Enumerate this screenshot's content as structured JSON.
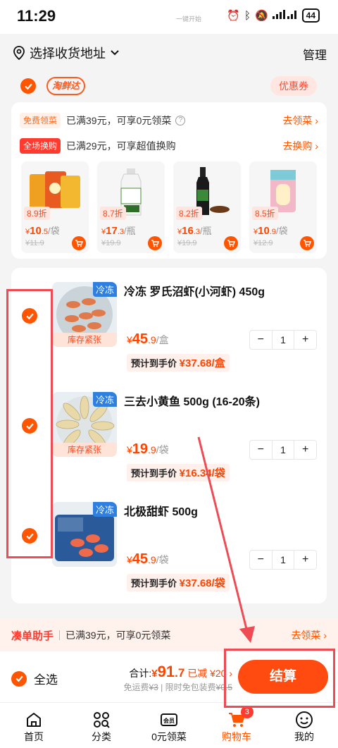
{
  "status_bar": {
    "time": "11:29",
    "carrier": "一键开始",
    "battery": "44"
  },
  "header": {
    "address_label": "选择收货地址",
    "manage": "管理"
  },
  "store": {
    "logo": "淘鲜达",
    "coupon": "优惠券"
  },
  "promos": [
    {
      "tag": "免费领菜",
      "text": "已满39元，可享0元领菜",
      "link": "去领菜 ›"
    },
    {
      "tag": "全场换购",
      "text": "已满29元，可享超值换购",
      "link": "去换购 ›"
    }
  ],
  "recommend": [
    {
      "discount": "8.9折",
      "price_int": "10",
      "price_dec": ".5",
      "unit": "/袋",
      "orig": "¥11.9"
    },
    {
      "discount": "8.7折",
      "price_int": "17",
      "price_dec": ".3",
      "unit": "/瓶",
      "orig": "¥19.9"
    },
    {
      "discount": "8.2折",
      "price_int": "16",
      "price_dec": ".3",
      "unit": "/瓶",
      "orig": "¥19.9"
    },
    {
      "discount": "8.5折",
      "price_int": "10",
      "price_dec": ".9",
      "unit": "/袋",
      "orig": "¥12.9"
    }
  ],
  "cart_items": [
    {
      "tag": "冷冻",
      "stock": "库存紧张",
      "title": "冷冻 罗氏沼虾(小河虾) 450g",
      "price_int": "45",
      "price_dec": ".9",
      "unit": "/盒",
      "qty": "1",
      "est_label": "预计到手价",
      "est_price": "¥37.68/盒"
    },
    {
      "tag": "冷冻",
      "stock": "库存紧张",
      "title": "三去小黄鱼 500g (16-20条)",
      "price_int": "19",
      "price_dec": ".9",
      "unit": "/袋",
      "qty": "1",
      "est_label": "预计到手价",
      "est_price": "¥16.34/袋"
    },
    {
      "tag": "冷冻",
      "stock": "",
      "title": "北极甜虾 500g",
      "price_int": "45",
      "price_dec": ".9",
      "unit": "/袋",
      "qty": "1",
      "est_label": "预计到手价",
      "est_price": "¥37.68/袋"
    }
  ],
  "stepper": {
    "minus": "−",
    "plus": "+"
  },
  "currency": "¥",
  "helper": {
    "title": "凑单助手",
    "text": "已满39元，可享0元领菜",
    "link": "去领菜 ›"
  },
  "checkout": {
    "select_all": "全选",
    "total_label": "合计:",
    "currency": "¥",
    "total_int": "91",
    "total_dec": ".7",
    "saved": "已减 ¥20 ›",
    "fee_line_a": "免运费",
    "fee_line_a_old": "¥3",
    "fee_line_b": "限时免包装费",
    "fee_line_b_old": "¥0.5",
    "button": "结算"
  },
  "tabs": [
    {
      "label": "首页",
      "icon": "home-icon"
    },
    {
      "label": "分类",
      "icon": "category-icon"
    },
    {
      "label": "0元领菜",
      "icon": "member-icon",
      "icon_text": "会员"
    },
    {
      "label": "购物车",
      "icon": "cart-icon",
      "badge": "3"
    },
    {
      "label": "我的",
      "icon": "profile-icon"
    }
  ],
  "colors": {
    "accent": "#ff5500",
    "annotation": "#ee4b55",
    "frozen_tag": "#2f7fe0"
  }
}
